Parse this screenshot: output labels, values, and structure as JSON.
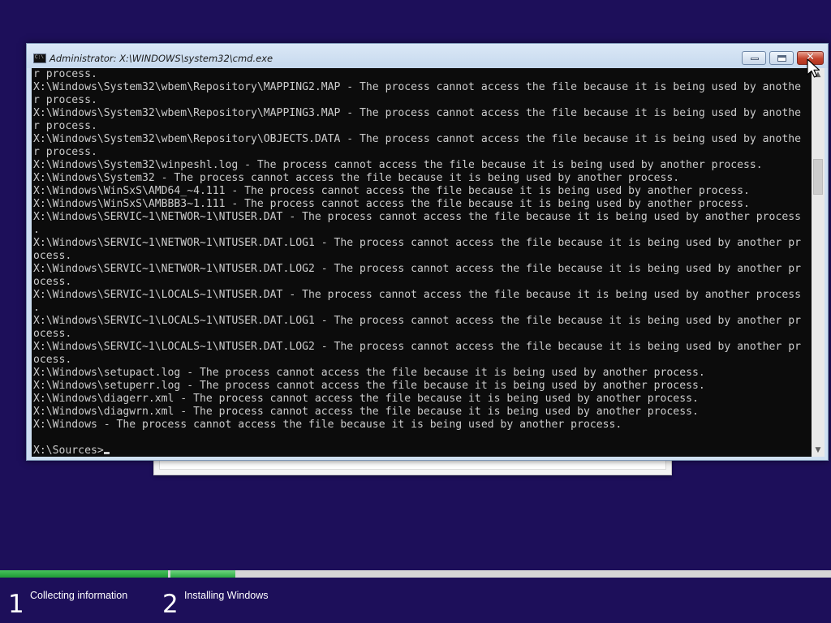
{
  "window": {
    "title": "Administrator: X:\\WINDOWS\\system32\\cmd.exe",
    "minimize_icon": "minimize-icon",
    "maximize_icon": "maximize-icon",
    "close_glyph": "✕"
  },
  "console": {
    "lines": [
      "r process.",
      "X:\\Windows\\System32\\wbem\\Repository\\MAPPING2.MAP - The process cannot access the file because it is being used by anothe",
      "r process.",
      "X:\\Windows\\System32\\wbem\\Repository\\MAPPING3.MAP - The process cannot access the file because it is being used by anothe",
      "r process.",
      "X:\\Windows\\System32\\wbem\\Repository\\OBJECTS.DATA - The process cannot access the file because it is being used by anothe",
      "r process.",
      "X:\\Windows\\System32\\winpeshl.log - The process cannot access the file because it is being used by another process.",
      "X:\\Windows\\System32 - The process cannot access the file because it is being used by another process.",
      "X:\\Windows\\WinSxS\\AMD64_~4.111 - The process cannot access the file because it is being used by another process.",
      "X:\\Windows\\WinSxS\\AMBBB3~1.111 - The process cannot access the file because it is being used by another process.",
      "X:\\Windows\\SERVIC~1\\NETWOR~1\\NTUSER.DAT - The process cannot access the file because it is being used by another process",
      ".",
      "X:\\Windows\\SERVIC~1\\NETWOR~1\\NTUSER.DAT.LOG1 - The process cannot access the file because it is being used by another pr",
      "ocess.",
      "X:\\Windows\\SERVIC~1\\NETWOR~1\\NTUSER.DAT.LOG2 - The process cannot access the file because it is being used by another pr",
      "ocess.",
      "X:\\Windows\\SERVIC~1\\LOCALS~1\\NTUSER.DAT - The process cannot access the file because it is being used by another process",
      ".",
      "X:\\Windows\\SERVIC~1\\LOCALS~1\\NTUSER.DAT.LOG1 - The process cannot access the file because it is being used by another pr",
      "ocess.",
      "X:\\Windows\\SERVIC~1\\LOCALS~1\\NTUSER.DAT.LOG2 - The process cannot access the file because it is being used by another pr",
      "ocess.",
      "X:\\Windows\\setupact.log - The process cannot access the file because it is being used by another process.",
      "X:\\Windows\\setuperr.log - The process cannot access the file because it is being used by another process.",
      "X:\\Windows\\diagerr.xml - The process cannot access the file because it is being used by another process.",
      "X:\\Windows\\diagwrn.xml - The process cannot access the file because it is being used by another process.",
      "X:\\Windows - The process cannot access the file because it is being used by another process.",
      ""
    ],
    "prompt": "X:\\Sources>"
  },
  "scrollbar": {
    "up_arrow": "▲",
    "down_arrow": "▼"
  },
  "progress": {
    "step1_complete_fraction": 1.0,
    "step2_complete_fraction": 0.1
  },
  "steps": [
    {
      "number": "1",
      "label": "Collecting information"
    },
    {
      "number": "2",
      "label": "Installing Windows"
    }
  ],
  "colors": {
    "desktop_background": "#1d0f5a",
    "console_background": "#0c0c0c",
    "console_text": "#cccccc",
    "progress_green": "#1f9a35"
  }
}
